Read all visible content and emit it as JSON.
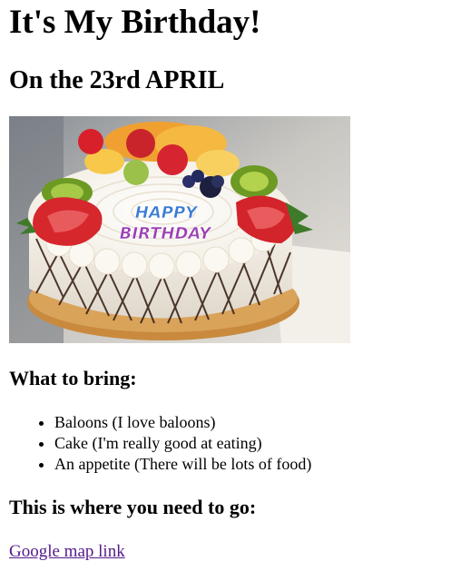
{
  "title": "It's My Birthday!",
  "date_heading": "On the 23rd APRIL",
  "cake_image": {
    "icon": "birthday-cake-photo",
    "cake_lettering": [
      "HAPPY",
      "BIRTHDAY"
    ]
  },
  "bring": {
    "heading": "What to bring:",
    "items": [
      "Baloons (I love baloons)",
      "Cake (I'm really good at eating)",
      "An appetite (There will be lots of food)"
    ]
  },
  "directions": {
    "heading": "This is where you need to go:",
    "link_text": "Google map link",
    "link_color": "#551a8b"
  }
}
